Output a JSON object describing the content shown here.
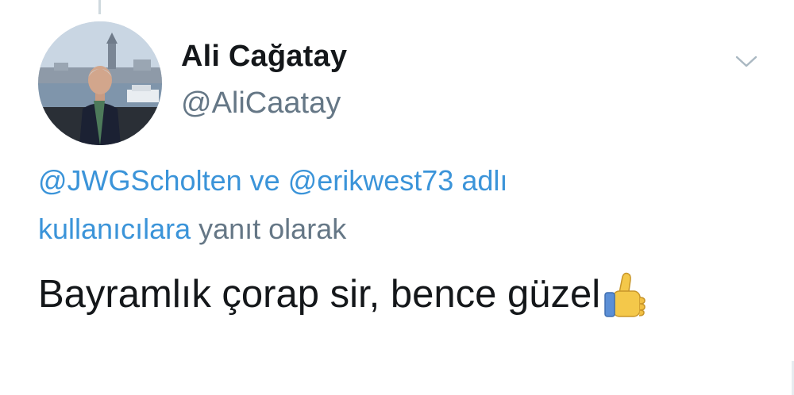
{
  "tweet": {
    "author_name": "Ali Cağatay",
    "author_handle": "@AliCaatay",
    "reply_to": {
      "mention_1": "@JWGScholten",
      "connector": "ve",
      "mention_2": "@erikwest73",
      "link_word_1": "adlı",
      "link_word_2": "kullanıcılara",
      "suffix": "yanıt olarak"
    },
    "text": "Bayramlık çorap sir, bence güzel",
    "emoji": "thumbs-up"
  },
  "icons": {
    "menu": "chevron-down-icon",
    "emoji": "thumbs-up-icon"
  },
  "colors": {
    "link": "#3b94d9",
    "secondary_text": "#657786",
    "primary_text": "#14171a",
    "thread_line": "#cfd9de"
  }
}
